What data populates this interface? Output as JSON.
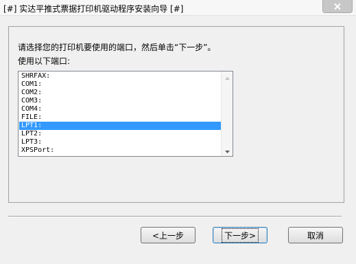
{
  "window": {
    "title": "[#] 实达平推式票据打印机驱动程序安装向导 [#]",
    "close_icon": "close-icon"
  },
  "main": {
    "instruction": "请选择您的打印机要使用的端口，然后单击“下一步”。",
    "ports_label": "使用以下端口:",
    "ports": [
      {
        "label": "SHRFAX:",
        "selected": false
      },
      {
        "label": "COM1:",
        "selected": false
      },
      {
        "label": "COM2:",
        "selected": false
      },
      {
        "label": "COM3:",
        "selected": false
      },
      {
        "label": "COM4:",
        "selected": false
      },
      {
        "label": "FILE:",
        "selected": false
      },
      {
        "label": "LPT1:",
        "selected": true
      },
      {
        "label": "LPT2:",
        "selected": false
      },
      {
        "label": "LPT3:",
        "selected": false
      },
      {
        "label": "XPSPort:",
        "selected": false
      }
    ]
  },
  "buttons": {
    "back": "<上一步",
    "next": "下一步>",
    "cancel": "取消"
  },
  "colors": {
    "selection": "#3399ff",
    "background": "#f0f0f0"
  }
}
